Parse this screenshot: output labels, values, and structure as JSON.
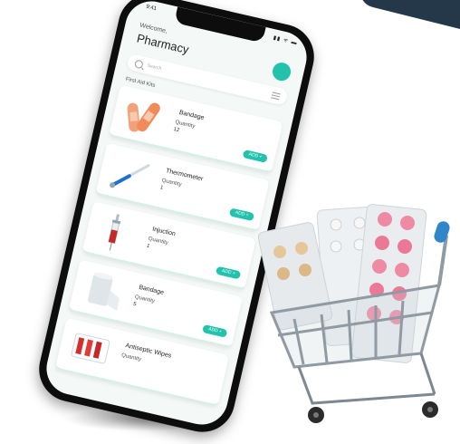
{
  "status_bar": {
    "time": "9:41",
    "icons": "▮▮ ᯤ ▬"
  },
  "header": {
    "welcome": "Welcome,",
    "title": "Pharmacy"
  },
  "search": {
    "placeholder": "Search"
  },
  "section_title": "First Aid Kits",
  "products": [
    {
      "name": "Bandage",
      "quantity_label": "Quantity",
      "quantity": "12",
      "add_label": "ADD +"
    },
    {
      "name": "Thermometer",
      "quantity_label": "Quantity",
      "quantity": "1",
      "add_label": "ADD +"
    },
    {
      "name": "Injuction",
      "quantity_label": "Quantity",
      "quantity": "1",
      "add_label": "ADD +"
    },
    {
      "name": "Bandage",
      "quantity_label": "Quantity",
      "quantity": "5",
      "add_label": "ADD +"
    },
    {
      "name": "Antiseptic Wipes",
      "quantity_label": "Quantity",
      "quantity": "",
      "add_label": ""
    }
  ],
  "colors": {
    "accent": "#22c2ad",
    "phone": "#0d0d0d",
    "corner": "#24384a",
    "card_edge": "#d5efe9"
  }
}
